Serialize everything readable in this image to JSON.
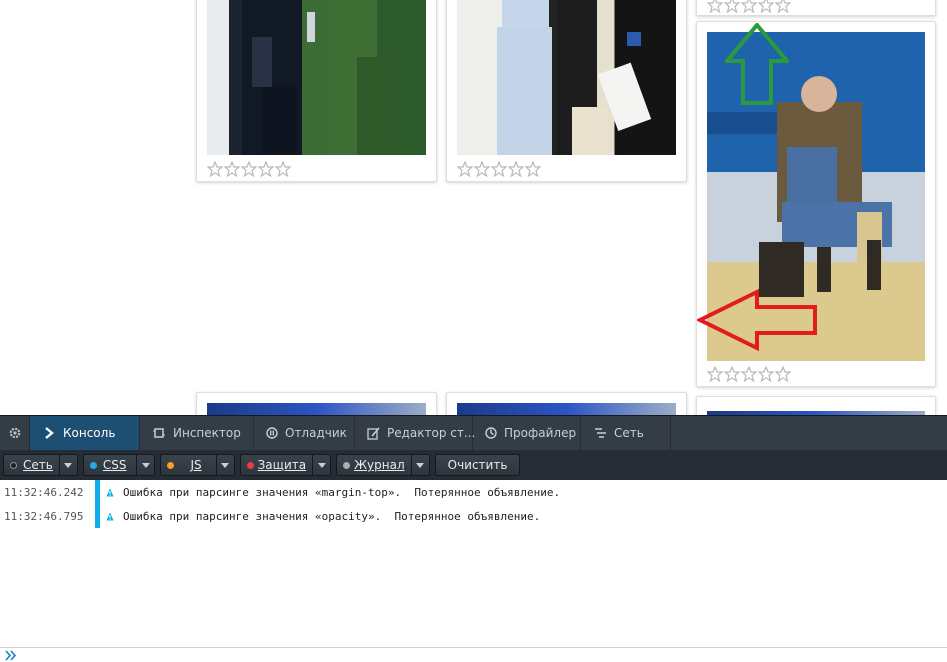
{
  "gallery": {
    "cards": [
      {
        "id": "card-1",
        "rating": 0,
        "max_rating": 5
      },
      {
        "id": "card-2",
        "rating": 0,
        "max_rating": 5
      },
      {
        "id": "card-3",
        "rating": 0,
        "max_rating": 5
      },
      {
        "id": "card-4",
        "rating": 0,
        "max_rating": 5
      }
    ],
    "arrows": {
      "green": "#2a9a3c",
      "red": "#e21b1b"
    }
  },
  "devtools": {
    "tabs": [
      {
        "label": "Консоль",
        "icon": "console-chevron-icon"
      },
      {
        "label": "Инспектор",
        "icon": "inspector-icon"
      },
      {
        "label": "Отладчик",
        "icon": "debugger-icon"
      },
      {
        "label": "Редактор ст...",
        "icon": "style-editor-icon"
      },
      {
        "label": "Профайлер",
        "icon": "profiler-icon"
      },
      {
        "label": "Сеть",
        "icon": "network-icon"
      }
    ],
    "filters": [
      {
        "label": "Сеть",
        "color": "#1c1f22"
      },
      {
        "label": "CSS",
        "color": "#27a9e3"
      },
      {
        "label": "JS",
        "color": "#f79f22"
      },
      {
        "label": "Защита",
        "color": "#ef3b3b"
      },
      {
        "label": "Журнал",
        "color": "#a7adb3"
      }
    ],
    "clear_label": "Очистить",
    "log": [
      {
        "time": "11:32:46.242",
        "message": "Ошибка при парсинге значения «margin-top».  Потерянное объявление."
      },
      {
        "time": "11:32:46.795",
        "message": "Ошибка при парсинге значения «opacity».  Потерянное объявление."
      }
    ],
    "colors": {
      "tabbar": "#343c45",
      "active_tab": "#1d4f73",
      "filterbar": "#252c33",
      "log_marker": "#0fb0e8"
    }
  }
}
